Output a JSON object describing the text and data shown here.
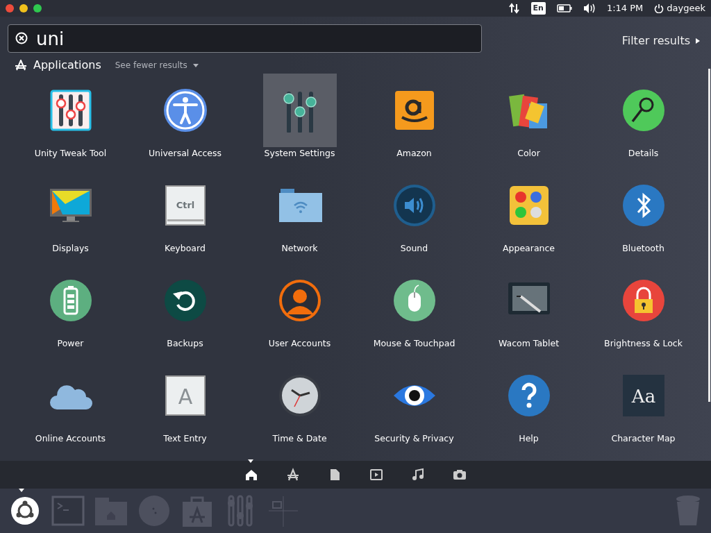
{
  "panel": {
    "keyboard_layout": "En",
    "clock": "1:14 PM",
    "user": "daygeek"
  },
  "search": {
    "value": "uni"
  },
  "filter": {
    "label": "Filter results"
  },
  "category": {
    "title": "Applications",
    "toggle": "See fewer results"
  },
  "apps": [
    {
      "label": "Unity Tweak Tool",
      "selected": false
    },
    {
      "label": "Universal Access",
      "selected": false
    },
    {
      "label": "System Settings",
      "selected": true
    },
    {
      "label": "Amazon",
      "selected": false
    },
    {
      "label": "Color",
      "selected": false
    },
    {
      "label": "Details",
      "selected": false
    },
    {
      "label": "Displays",
      "selected": false
    },
    {
      "label": "Keyboard",
      "icon_text": "Ctrl",
      "selected": false
    },
    {
      "label": "Network",
      "selected": false
    },
    {
      "label": "Sound",
      "selected": false
    },
    {
      "label": "Appearance",
      "selected": false
    },
    {
      "label": "Bluetooth",
      "selected": false
    },
    {
      "label": "Power",
      "selected": false
    },
    {
      "label": "Backups",
      "selected": false
    },
    {
      "label": "User Accounts",
      "selected": false
    },
    {
      "label": "Mouse & Touchpad",
      "selected": false
    },
    {
      "label": "Wacom Tablet",
      "selected": false
    },
    {
      "label": "Brightness & Lock",
      "selected": false
    },
    {
      "label": "Online Accounts",
      "selected": false
    },
    {
      "label": "Text Entry",
      "icon_text": "A",
      "selected": false
    },
    {
      "label": "Time & Date",
      "selected": false
    },
    {
      "label": "Security & Privacy",
      "selected": false
    },
    {
      "label": "Help",
      "selected": false
    },
    {
      "label": "Character Map",
      "icon_text": "Aa",
      "selected": false
    }
  ],
  "lenses": [
    {
      "selected": true
    },
    {
      "selected": false
    },
    {
      "selected": false
    },
    {
      "selected": false
    },
    {
      "selected": false
    },
    {
      "selected": false
    }
  ],
  "launcher": [
    {
      "active": true
    },
    {
      "active": false
    },
    {
      "active": false
    },
    {
      "active": false
    },
    {
      "active": false
    },
    {
      "active": false
    },
    {
      "active": false
    }
  ]
}
